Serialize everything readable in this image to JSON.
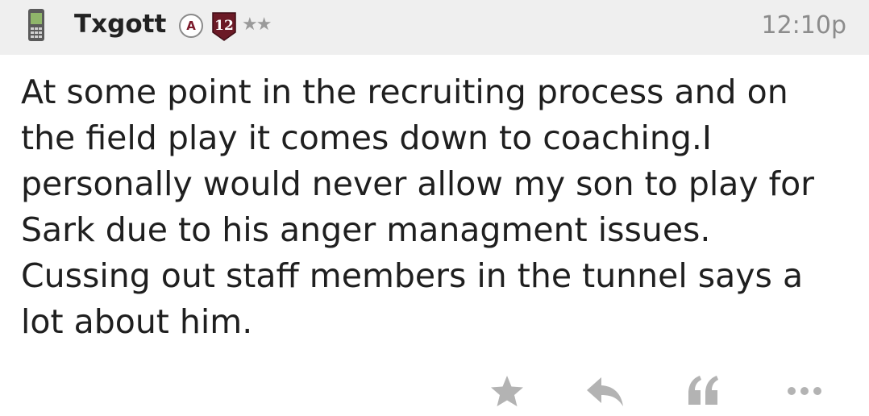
{
  "post": {
    "username": "Txgott",
    "badge_a": "A",
    "badge_level": "12",
    "stars": "★★",
    "timestamp": "12:10p",
    "body": "At some point in the recruiting process and on\nthe field play it comes down to coaching.I\npersonally would never allow my son to play for\nSark due to his anger managment issues.\nCussing out staff members in the tunnel says a\nlot about him."
  },
  "colors": {
    "header_bg": "#efefef",
    "badge_maroon": "#6b1a26",
    "icon_gray": "#b3b3b3",
    "phone_green": "#6b8f4a"
  },
  "icons": {
    "device": "phone-icon",
    "actions": [
      "star-icon",
      "reply-icon",
      "quote-icon",
      "more-icon"
    ]
  }
}
